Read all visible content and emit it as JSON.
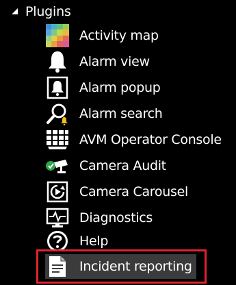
{
  "tree": {
    "group_label": "Plugins",
    "items": [
      {
        "label": "Activity map",
        "icon": "activity-map-icon"
      },
      {
        "label": "Alarm view",
        "icon": "bell-icon"
      },
      {
        "label": "Alarm popup",
        "icon": "alarm-popup-icon"
      },
      {
        "label": "Alarm search",
        "icon": "alarm-search-icon"
      },
      {
        "label": "AVM Operator Console",
        "icon": "operator-console-icon"
      },
      {
        "label": "Camera Audit",
        "icon": "camera-audit-icon"
      },
      {
        "label": "Camera Carousel",
        "icon": "camera-carousel-icon"
      },
      {
        "label": "Diagnostics",
        "icon": "diagnostics-icon"
      },
      {
        "label": "Help",
        "icon": "help-icon"
      },
      {
        "label": "Incident reporting",
        "icon": "incident-report-icon"
      }
    ]
  },
  "colors": {
    "background": "#000000",
    "text": "#ffffff",
    "selected_background": "#3b3b3b",
    "highlight_border": "#e0242b"
  }
}
